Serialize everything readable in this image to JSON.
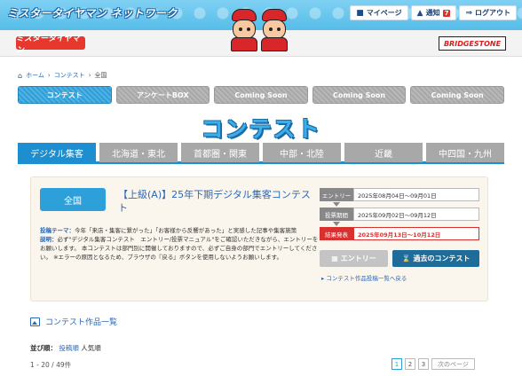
{
  "header": {
    "site_title": "ミスタータイヤマン ネットワーク",
    "actions": [
      {
        "label": "マイページ",
        "icon": "user-icon"
      },
      {
        "label": "通知",
        "badge": "7",
        "icon": "bell-icon"
      },
      {
        "label": "ログアウト",
        "icon": "logout-icon"
      }
    ],
    "logo_left": "ミスタータイヤマン",
    "logo_right": "BRIDGESTONE"
  },
  "breadcrumb": [
    "ホーム",
    "コンテスト",
    "全国"
  ],
  "nav": [
    {
      "label": "コンテスト",
      "active": true
    },
    {
      "label": "アンケートBOX",
      "active": false
    },
    {
      "label": "Coming Soon",
      "active": false
    },
    {
      "label": "Coming Soon",
      "active": false
    },
    {
      "label": "Coming Soon",
      "active": false
    }
  ],
  "page_title": "コンテスト",
  "regions": [
    {
      "label": "デジタル集客",
      "active": true
    },
    {
      "label": "北海道・東北",
      "active": false
    },
    {
      "label": "首都圏・関東",
      "active": false
    },
    {
      "label": "中部・北陸",
      "active": false
    },
    {
      "label": "近畿",
      "active": false
    },
    {
      "label": "中四国・九州",
      "active": false
    }
  ],
  "contest": {
    "scope_button": "全国",
    "title": "【上級(A)】25年下期デジタル集客コンテスト",
    "theme_label": "投稿テーマ：",
    "theme_text": "今年「来店・集客に繋がった」「お客様から反響があった」と実感した記事や集客施策",
    "note_label": "説明：",
    "note_text": "必ず\"デジタル集客コンテスト　エントリー/投票マニュアル\"をご確認いただきながら、エントリーをお願いします。 本コンテストは部門別に開催しておりますので、必ずご自身の部門でエントリーしてください。 ※エラーの原因となるため、ブラウザの『戻る』ボタンを使用しないようお願いします。",
    "schedule": [
      {
        "label": "エントリー",
        "value": "2025年08月04日～09月01日",
        "highlight": false
      },
      {
        "label": "投票期間",
        "value": "2025年09月02日～09月12日",
        "highlight": false
      },
      {
        "label": "結果発表",
        "value": "2025年09月13日～10月12日",
        "highlight": true
      }
    ],
    "entry_button": "エントリー",
    "past_button": "過去のコンテスト",
    "works_link": "コンテスト作品投稿一覧へ戻る"
  },
  "list": {
    "heading": "コンテスト作品一覧",
    "sort_label": "並び順：",
    "sort_options": [
      "投稿順",
      "人気順"
    ],
    "count_text": "1 - 20 / 49件",
    "pages": [
      "1",
      "2",
      "3"
    ],
    "current_page": "1",
    "next_label": "次のページ"
  }
}
